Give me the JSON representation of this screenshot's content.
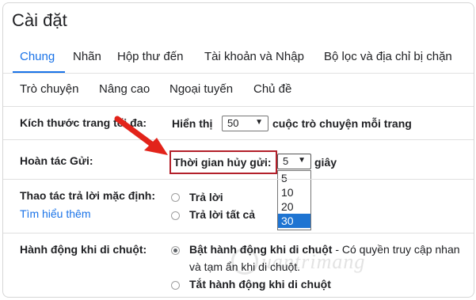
{
  "title": "Cài đặt",
  "tabs_row1": [
    "Chung",
    "Nhãn",
    "Hộp thư đến",
    "Tài khoản và Nhập",
    "Bộ lọc và địa chỉ bị chặn"
  ],
  "tabs_row2": [
    "Trò chuyện",
    "Nâng cao",
    "Ngoại tuyến",
    "Chủ đề"
  ],
  "active_tab": "Chung",
  "page_size": {
    "label": "Kích thước trang tối đa:",
    "show_label": "Hiển thị",
    "value": "50",
    "suffix": "cuộc trò chuyện mỗi trang"
  },
  "undo_send": {
    "label": "Hoàn tác Gửi:",
    "cancel_label": "Thời gian hủy gửi:",
    "value": "5",
    "unit": "giây",
    "options": [
      "5",
      "10",
      "20",
      "30"
    ],
    "highlighted_option": "30"
  },
  "reply_default": {
    "label": "Thao tác trả lời mặc định:",
    "learn_more": "Tìm hiểu thêm",
    "options": [
      "Trả lời",
      "Trả lời tất cả"
    ]
  },
  "hover_actions": {
    "label": "Hành động khi di chuột:",
    "enable_label": "Bật hành động khi di chuột",
    "enable_desc": " - Có quyền truy cập nhan",
    "enable_desc_line2": "và tạm ẩn khi di chuột.",
    "disable_label": "Tắt hành động khi di chuột"
  },
  "watermark": "uantrimang",
  "colors": {
    "accent": "#1a73e8",
    "highlight": "#b3202a",
    "arrow": "#e2231a",
    "selected_option": "#1e74d2"
  }
}
